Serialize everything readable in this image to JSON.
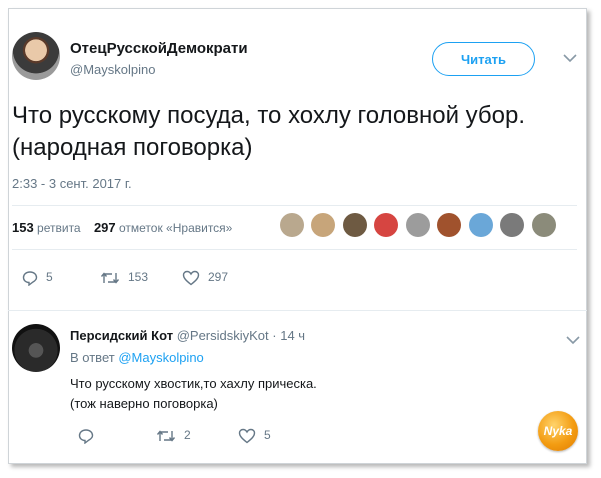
{
  "tweet": {
    "author_name": "ОтецРусскойДемократи",
    "author_handle": "@Mayskolpino",
    "follow_label": "Читать",
    "text": "Что русскому посуда, то хохлу головной убор.(народная поговорка)",
    "timestamp": "2:33 - 3 сент. 2017 г.",
    "retweet_count": "153",
    "retweet_label": "ретвита",
    "like_count": "297",
    "like_label": "отметок «Нравится»",
    "actions": {
      "replies": "5",
      "retweets": "153",
      "likes": "297"
    }
  },
  "reply": {
    "author_name": "Персидский Кот",
    "author_handle": "@PersidskiyKot",
    "time": "· 14 ч",
    "in_reply_prefix": "В ответ",
    "in_reply_handle": "@Mayskolpino",
    "text_line1": "Что русскому хвостик,то хахлу прическа.",
    "text_line2": "(тож наверно поговорка)",
    "actions": {
      "replies": "",
      "retweets": "2",
      "likes": "5"
    }
  },
  "watermark": {
    "text": "Nyka"
  },
  "colors": {
    "accent": "#1da1f2",
    "secondary": "#657786",
    "divider": "#e6ecf0"
  },
  "icons": [
    "reply-icon",
    "retweet-icon",
    "like-icon",
    "chevron-down-icon"
  ]
}
